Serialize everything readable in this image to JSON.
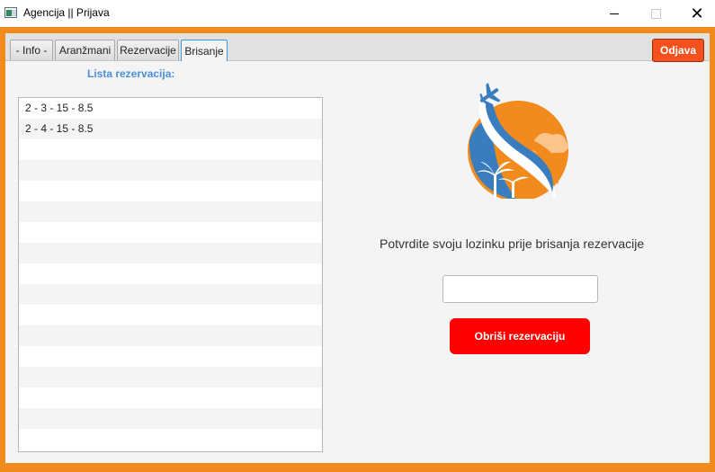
{
  "window": {
    "title": "Agencija || Prijava"
  },
  "tabs": [
    {
      "label": "- Info -"
    },
    {
      "label": "Aranžmani"
    },
    {
      "label": "Rezervacije"
    },
    {
      "label": "Brisanje"
    }
  ],
  "logout_label": "Odjava",
  "reservations": {
    "title": "Lista rezervacija:",
    "items": [
      "2 - 3 - 15 - 8.5",
      "2 - 4 - 15 - 8.5"
    ]
  },
  "delete_form": {
    "prompt": "Potvrdite svoju lozinku prije brisanja rezervacije",
    "password_value": "",
    "button_label": "Obriši rezervaciju"
  },
  "colors": {
    "frame": "#f28b1e",
    "logout": "#f4511e",
    "delete_button": "#ff0000",
    "list_title": "#4a90d9"
  }
}
